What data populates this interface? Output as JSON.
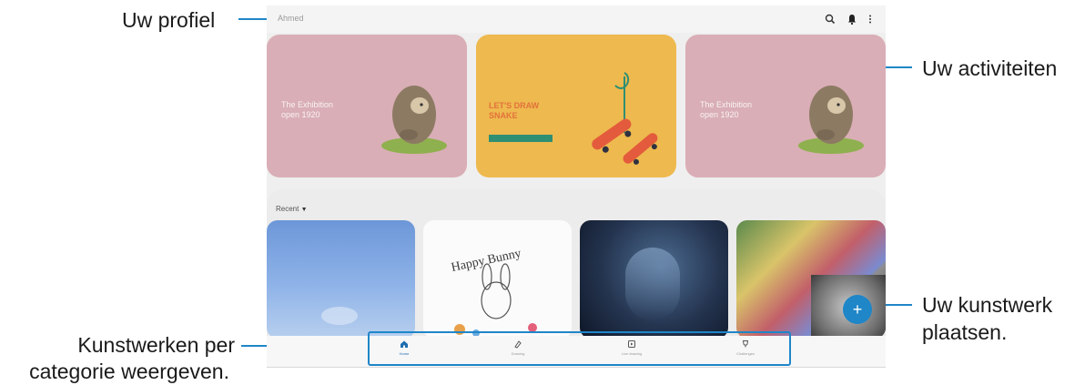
{
  "callouts": {
    "profile": "Uw profiel",
    "activities": "Uw activiteiten",
    "post_line1": "Uw kunstwerk",
    "post_line2": "plaatsen.",
    "categories_line1": "Kunstwerken per",
    "categories_line2": "categorie weergeven."
  },
  "topbar": {
    "profile_name": "Ahmed",
    "icons": [
      "search-icon",
      "bell-icon",
      "more-options-icon"
    ]
  },
  "banners": [
    {
      "title": "The Exhibition\nopen 1920"
    },
    {
      "title": "LET'S DRAW\nSNAKE"
    },
    {
      "title": "The Exhibition\nopen 1920"
    }
  ],
  "gallery": {
    "category_label": "Recent"
  },
  "fab": {
    "label": "+"
  },
  "bottom_nav": {
    "items": [
      {
        "label": "Home",
        "icon": "home-icon"
      },
      {
        "label": "Drawing",
        "icon": "brush-icon"
      },
      {
        "label": "Live drawing",
        "icon": "live-icon"
      },
      {
        "label": "Challenges",
        "icon": "trophy-icon"
      }
    ]
  },
  "colors": {
    "accent": "#1f86c8",
    "banner_pink": "#d9aeb6",
    "banner_yellow": "#eeb94e",
    "callout_text": "#1a1a1a"
  }
}
